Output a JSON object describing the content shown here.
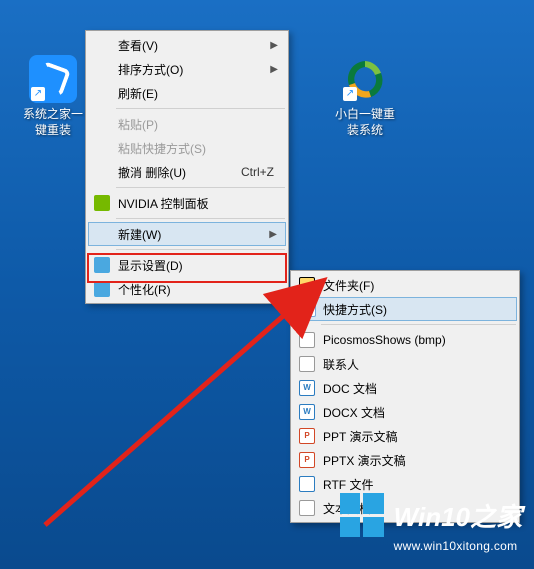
{
  "desktop": {
    "icons": [
      {
        "name": "系统之家一键重装",
        "badge": "↗"
      },
      {
        "name": "小白一键重装系统",
        "badge": "↗"
      }
    ]
  },
  "menu1": {
    "items": [
      {
        "label": "查看(V)",
        "submenu": true
      },
      {
        "label": "排序方式(O)",
        "submenu": true
      },
      {
        "label": "刷新(E)"
      },
      {
        "sep": true
      },
      {
        "label": "粘贴(P)",
        "disabled": true
      },
      {
        "label": "粘贴快捷方式(S)",
        "disabled": true
      },
      {
        "label": "撤消 删除(U)",
        "shortcut": "Ctrl+Z"
      },
      {
        "sep": true
      },
      {
        "label": "NVIDIA 控制面板",
        "icon": "nvidia"
      },
      {
        "sep": true
      },
      {
        "label": "新建(W)",
        "submenu": true,
        "hover": true
      },
      {
        "sep": true
      },
      {
        "label": "显示设置(D)",
        "icon": "display"
      },
      {
        "label": "个性化(R)",
        "icon": "personalize"
      }
    ]
  },
  "menu2": {
    "items": [
      {
        "label": "文件夹(F)",
        "icon": "folder"
      },
      {
        "label": "快捷方式(S)",
        "icon": "shortcut",
        "hover": true
      },
      {
        "sep": true
      },
      {
        "label": "PicosmosShows (bmp)",
        "icon": "bmp"
      },
      {
        "label": "联系人",
        "icon": "contact"
      },
      {
        "label": "DOC 文档",
        "icon": "doc"
      },
      {
        "label": "DOCX 文档",
        "icon": "docx"
      },
      {
        "label": "PPT 演示文稿",
        "icon": "ppt"
      },
      {
        "label": "PPTX 演示文稿",
        "icon": "pptx"
      },
      {
        "label": "RTF 文件",
        "icon": "rtf"
      },
      {
        "label": "文本文档",
        "icon": "txt"
      }
    ]
  },
  "watermark": {
    "brand": "Win10之家",
    "url": "www.win10xitong.com"
  }
}
